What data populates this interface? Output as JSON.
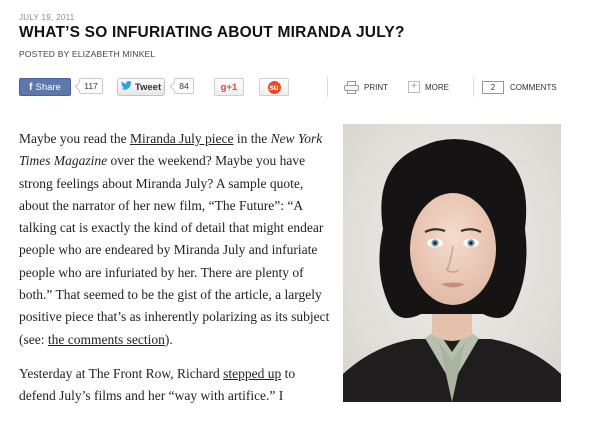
{
  "post": {
    "date": "JULY 19, 2011",
    "title": "WHAT’S SO INFURIATING ABOUT MIRANDA JULY?",
    "byline": "POSTED BY ELIZABETH MINKEL"
  },
  "share": {
    "facebook": {
      "icon": "facebook-icon",
      "glyph": "f",
      "label": "Share",
      "count": "117",
      "color": "#5f78ab"
    },
    "twitter": {
      "icon": "twitter-bird-icon",
      "label": "Tweet",
      "count": "84"
    },
    "google_plus": {
      "icon": "google-plus-icon",
      "label": "g+1"
    },
    "stumbleupon": {
      "icon": "stumbleupon-icon",
      "glyph": "su"
    },
    "print": {
      "icon": "printer-icon",
      "label": "PRINT"
    },
    "more": {
      "icon": "plus-icon",
      "glyph": "+",
      "label": "MORE"
    },
    "comments": {
      "count": "2",
      "label": "COMMENTS"
    }
  },
  "article": {
    "p1": {
      "t1": "Maybe you read the ",
      "link1": "Miranda July piece",
      "t2": " in the ",
      "em1": "New York Times Magazine",
      "t3": " over the weekend? Maybe you have strong feelings about Miranda July? A sample quote, about the narrator of her new film, “The Future”: “A talking cat is exactly the kind of detail that might endear people who are endeared by Miranda July and infuriate people who are infuriated by her. There are plenty of both.” That seemed to be the gist of the article, a largely positive piece that’s as inherently polarizing as its subject (see: ",
      "link2": "the comments section",
      "t4": ")."
    },
    "p2": {
      "t1": "Yesterday at The Front Row, Richard ",
      "link1": "stepped up",
      "t2": " to defend July’s films and her “way with artifice.” I"
    }
  },
  "photo": {
    "alt": "Portrait of Miranda July"
  }
}
